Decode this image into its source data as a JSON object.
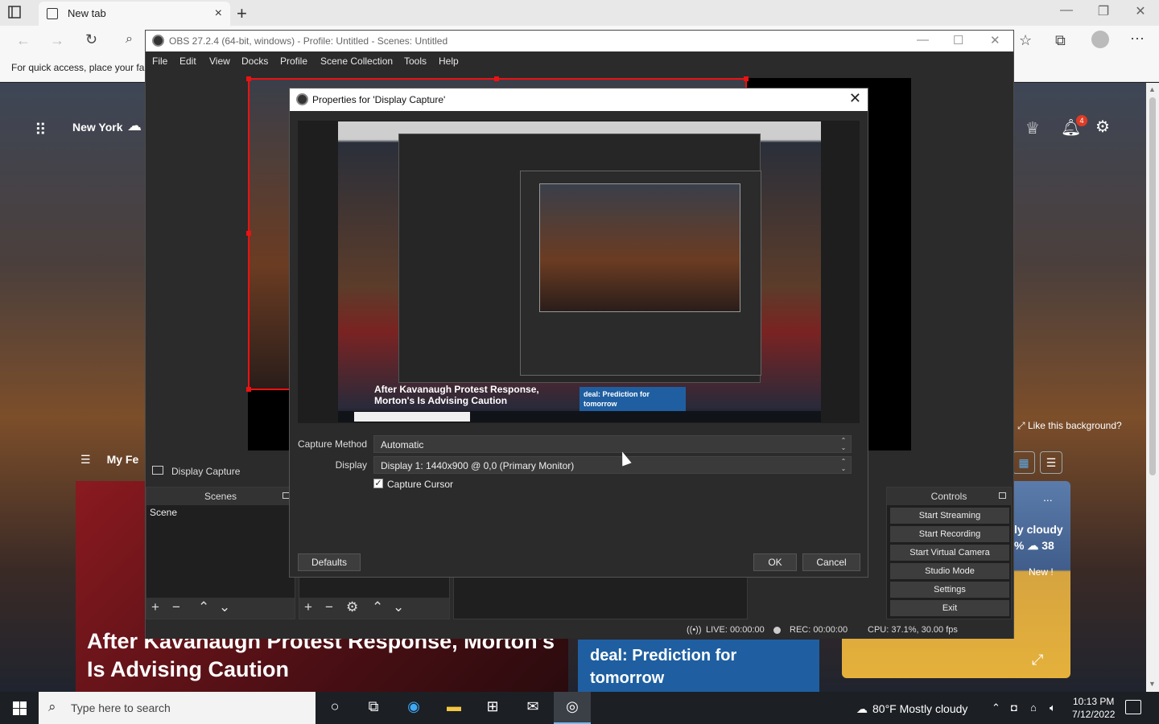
{
  "browser": {
    "tab_title": "New tab",
    "new_tab_glyph": "+",
    "fav_hint": "For quick access, place your fa"
  },
  "ntp": {
    "city": "New York",
    "notification_count": "4",
    "like_background": "Like this background?",
    "my_feed": "My Fe",
    "news_headline": "After Kavanaugh Protest Response, Morton's Is Advising Caution",
    "deal_headline": "deal: Prediction for tomorrow",
    "weather_line1": "ly cloudy",
    "weather_line2": "%  ☁ 38",
    "weather_new": "New !",
    "weather_more": "..."
  },
  "obs": {
    "title": "OBS 27.2.4 (64-bit, windows) - Profile: Untitled - Scenes: Untitled",
    "menu": [
      "File",
      "Edit",
      "View",
      "Docks",
      "Profile",
      "Scene Collection",
      "Tools",
      "Help"
    ],
    "source_label": "Display Capture",
    "scenes_header": "Scenes",
    "scene_item": "Scene",
    "controls_header": "Controls",
    "controls": [
      "Start Streaming",
      "Start Recording",
      "Start Virtual Camera",
      "Studio Mode",
      "Settings",
      "Exit"
    ],
    "status_live": "LIVE: 00:00:00",
    "status_rec": "REC: 00:00:00",
    "status_cpu": "CPU: 37.1%, 30.00 fps"
  },
  "dialog": {
    "title": "Properties for 'Display Capture'",
    "capture_method_label": "Capture Method",
    "capture_method_value": "Automatic",
    "display_label": "Display",
    "display_value": "Display 1: 1440x900 @ 0,0 (Primary Monitor)",
    "capture_cursor_label": "Capture Cursor",
    "capture_cursor_checked": true,
    "defaults_button": "Defaults",
    "ok_button": "OK",
    "cancel_button": "Cancel",
    "nested_headline": "After Kavanaugh Protest Response, Morton's Is Advising Caution",
    "nested_deal": "deal: Prediction for tomorrow"
  },
  "taskbar": {
    "search_placeholder": "Type here to search",
    "weather": "80°F  Mostly cloudy",
    "time": "10:13 PM",
    "date": "7/12/2022"
  },
  "colors": {
    "selection_red": "#ee1111",
    "obs_bg": "#2b2b2b",
    "taskbar_bg": "#1c1f24",
    "deal_blue": "#1f5fa1"
  }
}
